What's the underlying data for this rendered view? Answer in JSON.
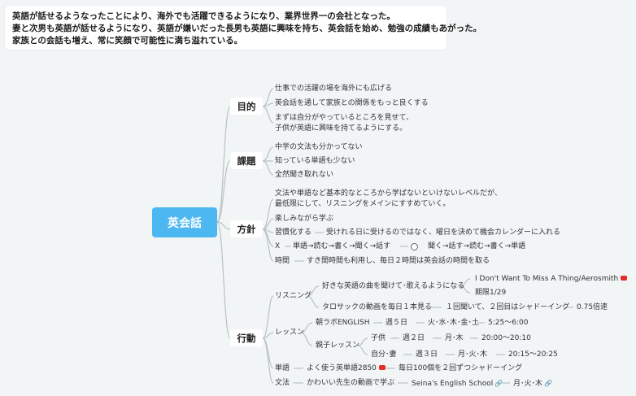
{
  "summary": [
    "英語が話せるようなったことにより、海外でも活躍できるようになり、業界世界一の会社となった。",
    "妻と次男も英語が話せるようになり、英語が嫌いだった長男も英語に興味を持ち、英会話を始め、勉強の成績もあがった。",
    "家族との会話も増え、常に笑顔で可能性に満ち溢れている。"
  ],
  "root": "英会話",
  "branches": {
    "mokuteki": "目的",
    "kadai": "課題",
    "houshin": "方針",
    "koudou": "行動"
  },
  "mokuteki": {
    "a": "仕事での活躍の場を海外にも広げる",
    "b": "英会話を通して家族との関係をもっと良くする",
    "c1": "まずは自分がやっているところを見せて、",
    "c2": "子供が英語に興味を持てるようにする。"
  },
  "kadai": {
    "a": "中学の文法も分かってない",
    "b": "知っている単語も少ない",
    "c": "全然聞き取れない"
  },
  "houshin": {
    "a1": "文法や単語など基本的なところから学ばないといけないレベルだが、",
    "a2": "最低限にして、リスニングをメインにすすめていく。",
    "b": "楽しみながら学ぶ",
    "c": "習慣化する",
    "c2": "受けれる日に受けるのではなく、曜日を決めて機会カレンダーに入れる",
    "d": "X",
    "d2": "単語→読む→書く→聞く→話す",
    "d3": "聞く→話す→読む→書く→単語",
    "e": "時間",
    "e2": "すき間時間も利用し、毎日２時間は英会話の時間を取る"
  },
  "koudou": {
    "listening": "リスニング",
    "song": "好きな英語の曲を聞けて･歌えるようになる",
    "song_title": "I Don't Want To Miss A Thing/Aerosmith",
    "deadline": "期限1/29",
    "taro": "タロサックの動画を毎日１本見る",
    "taro2": "１回聞いて、２回目はシャドーイング",
    "taro3": "0.75倍速",
    "lesson": "レッスン",
    "asa": "朝ラボENGLISH",
    "asa2": "週５日",
    "asa3": "火･水･木･金･土",
    "asa4": "5:25〜6:00",
    "oya": "親子レッスン",
    "kodomo": "子供",
    "kodomo2": "週２日",
    "kodomo3": "月･木",
    "kodomo4": "20:00〜20:10",
    "jibun": "自分･妻",
    "jibun2": "週３日",
    "jibun3": "月･火･木",
    "jibun4": "20:15〜20:25",
    "tango": "単語",
    "tango2": "よく使う英単語2850",
    "tango3": "毎日100個を２回ずつシャドーイング",
    "bunpou": "文法",
    "bunpou2": "かわいい先生の動画で学ぶ",
    "bunpou3": "Seina's English School",
    "bunpou4": "月･火･木"
  },
  "colors": {
    "root": "#4db7f2",
    "line": "#b7c1c6",
    "youtube": "#e52d27",
    "link": "#4a7fd9"
  }
}
